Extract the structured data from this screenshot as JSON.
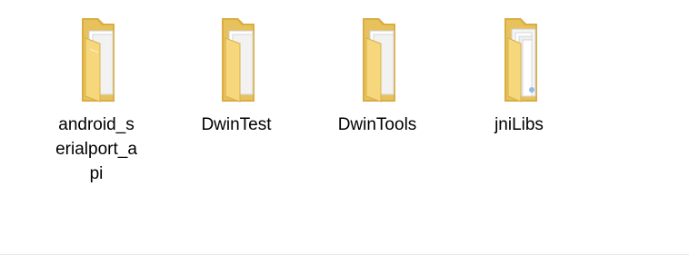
{
  "folders": [
    {
      "name": "android_serialport_api",
      "label_lines": [
        "android_s",
        "erialport_a",
        "pi"
      ],
      "icon": "folder-with-documents-icon"
    },
    {
      "name": "DwinTest",
      "label_lines": [
        "DwinTest"
      ],
      "icon": "folder-with-documents-icon"
    },
    {
      "name": "DwinTools",
      "label_lines": [
        "DwinTools"
      ],
      "icon": "folder-with-documents-icon"
    },
    {
      "name": "jniLibs",
      "label_lines": [
        "jniLibs"
      ],
      "icon": "folder-with-files-icon"
    }
  ],
  "colors": {
    "folder_back": "#e7c25c",
    "folder_front": "#f6d77b",
    "paper": "#f7f7f7"
  }
}
